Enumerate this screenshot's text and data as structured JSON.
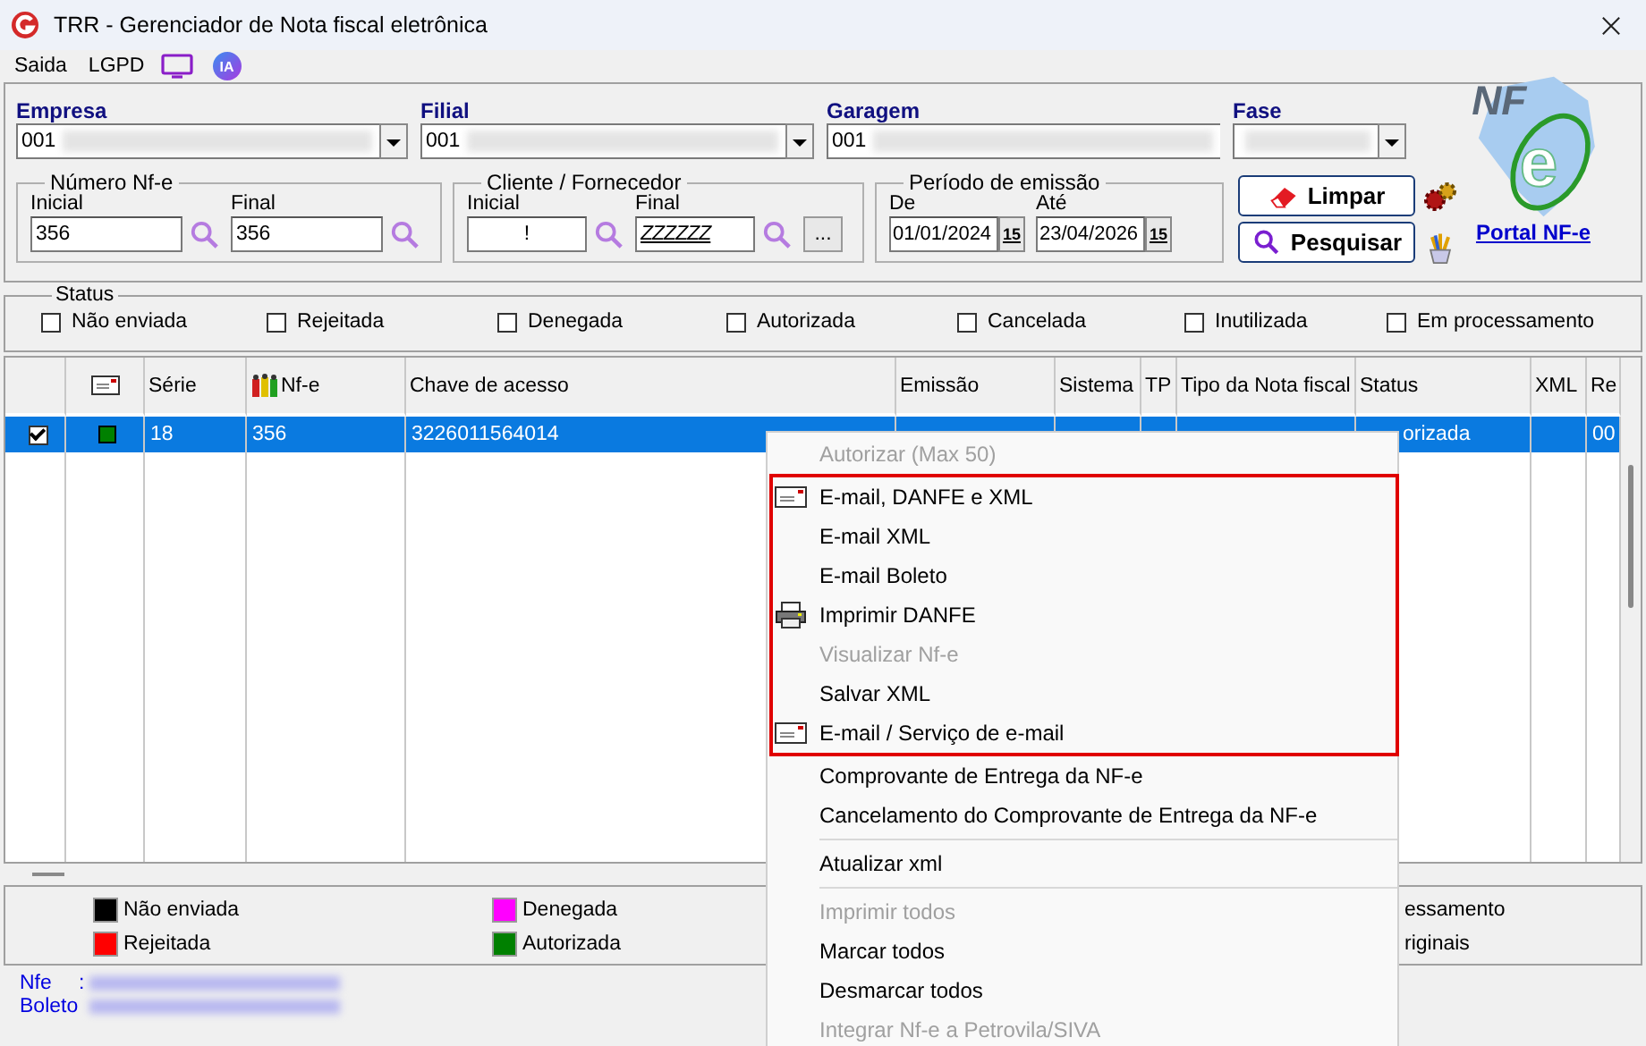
{
  "window": {
    "title": "TRR - Gerenciador de Nota fiscal eletrônica"
  },
  "menu_bar": {
    "items": [
      {
        "label": "Saida"
      },
      {
        "label": "LGPD"
      }
    ],
    "ai_badge": "IA"
  },
  "combos": [
    {
      "label": "Empresa",
      "value": "001",
      "dropdown": true
    },
    {
      "label": "Filial",
      "value": "001",
      "dropdown": true
    },
    {
      "label": "Garagem",
      "value": "001",
      "dropdown": false
    },
    {
      "label": "Fase",
      "dropdown": true
    }
  ],
  "groups": [
    {
      "title": "Número Nf-e",
      "kind": "number",
      "fields": [
        {
          "label": "Inicial",
          "value": "356"
        },
        {
          "label": "Final",
          "value": "356"
        }
      ]
    },
    {
      "title": "Cliente / Fornecedor",
      "kind": "client",
      "fields": [
        {
          "label": "Inicial",
          "value": "!"
        },
        {
          "label": "Final",
          "value": "ZZZZZZ"
        }
      ],
      "more_button": "..."
    },
    {
      "title": "Período de emissão",
      "kind": "date",
      "fields": [
        {
          "label": "De",
          "value": "01/01/2024",
          "calendar": "15"
        },
        {
          "label": "Até",
          "value": "23/04/2026",
          "calendar": "15"
        }
      ]
    }
  ],
  "buttons": [
    {
      "label": "Limpar",
      "kind": "clear"
    },
    {
      "label": "Pesquisar",
      "kind": "search"
    }
  ],
  "logo": {
    "mark": "NF",
    "letter": "e",
    "link": "Portal NF-e"
  },
  "status_filter": {
    "title": "Status",
    "options": [
      {
        "label": "Não enviada",
        "checked": false
      },
      {
        "label": "Rejeitada",
        "checked": false
      },
      {
        "label": "Denegada",
        "checked": false
      },
      {
        "label": "Autorizada",
        "checked": false
      },
      {
        "label": "Cancelada",
        "checked": false
      },
      {
        "label": "Inutilizada",
        "checked": false
      },
      {
        "label": "Em processamento",
        "checked": false
      }
    ]
  },
  "table": {
    "columns": [
      {
        "kind": "check"
      },
      {
        "kind": "icon"
      },
      {
        "kind": "text",
        "label": "Série"
      },
      {
        "kind": "icon_text",
        "label": "Nf-e"
      },
      {
        "kind": "text",
        "label": "Chave de acesso"
      },
      {
        "kind": "text",
        "label": "Emissão"
      },
      {
        "kind": "text",
        "label": "Sistema"
      },
      {
        "kind": "text",
        "label": "TP"
      },
      {
        "kind": "text",
        "label": "Tipo da Nota fiscal"
      },
      {
        "kind": "text",
        "label": "Status"
      },
      {
        "kind": "text",
        "label": "XML"
      },
      {
        "kind": "text",
        "label": "Re"
      }
    ],
    "rows": [
      {
        "selected": true,
        "checked": true,
        "color": "#008000",
        "serie": "18",
        "nfe": "356",
        "chave": "3226011564014",
        "status": "orizada",
        "column_12": "00"
      }
    ]
  },
  "legend": [
    {
      "label": "Não enviada",
      "color": "#000000"
    },
    {
      "label": "Denegada",
      "color": "#ff00ff"
    },
    {
      "label": "Rejeitada",
      "color": "#ff0000"
    },
    {
      "label": "Autorizada",
      "color": "#008000"
    }
  ],
  "legend_cut": [
    "essamento",
    "riginais"
  ],
  "footer": [
    {
      "label": "Nfe",
      "separator": ":"
    },
    {
      "label": "Boleto"
    }
  ],
  "context_menu": {
    "groups": [
      {
        "boxed": false,
        "items": [
          {
            "label": "Autorizar (Max 50)",
            "disabled": true
          }
        ]
      },
      {
        "boxed": true,
        "items": [
          {
            "label": "E-mail, DANFE e XML",
            "disabled": false,
            "kind": "mail"
          },
          {
            "label": "E-mail XML",
            "disabled": false
          },
          {
            "label": "E-mail Boleto",
            "disabled": false
          },
          {
            "label": "Imprimir DANFE",
            "disabled": false,
            "kind": "print"
          },
          {
            "label": "Visualizar Nf-e",
            "disabled": true
          },
          {
            "label": "Salvar XML",
            "disabled": false
          },
          {
            "label": "E-mail / Serviço de e-mail",
            "disabled": false,
            "kind": "mail"
          }
        ]
      },
      {
        "boxed": false,
        "items": [
          {
            "label": "Comprovante de Entrega da NF-e",
            "disabled": false
          },
          {
            "label": "Cancelamento do Comprovante de Entrega da NF-e",
            "disabled": false
          },
          {
            "label": "Atualizar xml",
            "disabled": false,
            "separator_before": true
          },
          {
            "label": "Imprimir todos",
            "disabled": true,
            "separator_before": true
          },
          {
            "label": "Marcar todos",
            "disabled": false
          },
          {
            "label": "Desmarcar todos",
            "disabled": false
          },
          {
            "label": "Integrar Nf-e a Petrovila/SIVA",
            "disabled": true
          }
        ]
      }
    ]
  }
}
